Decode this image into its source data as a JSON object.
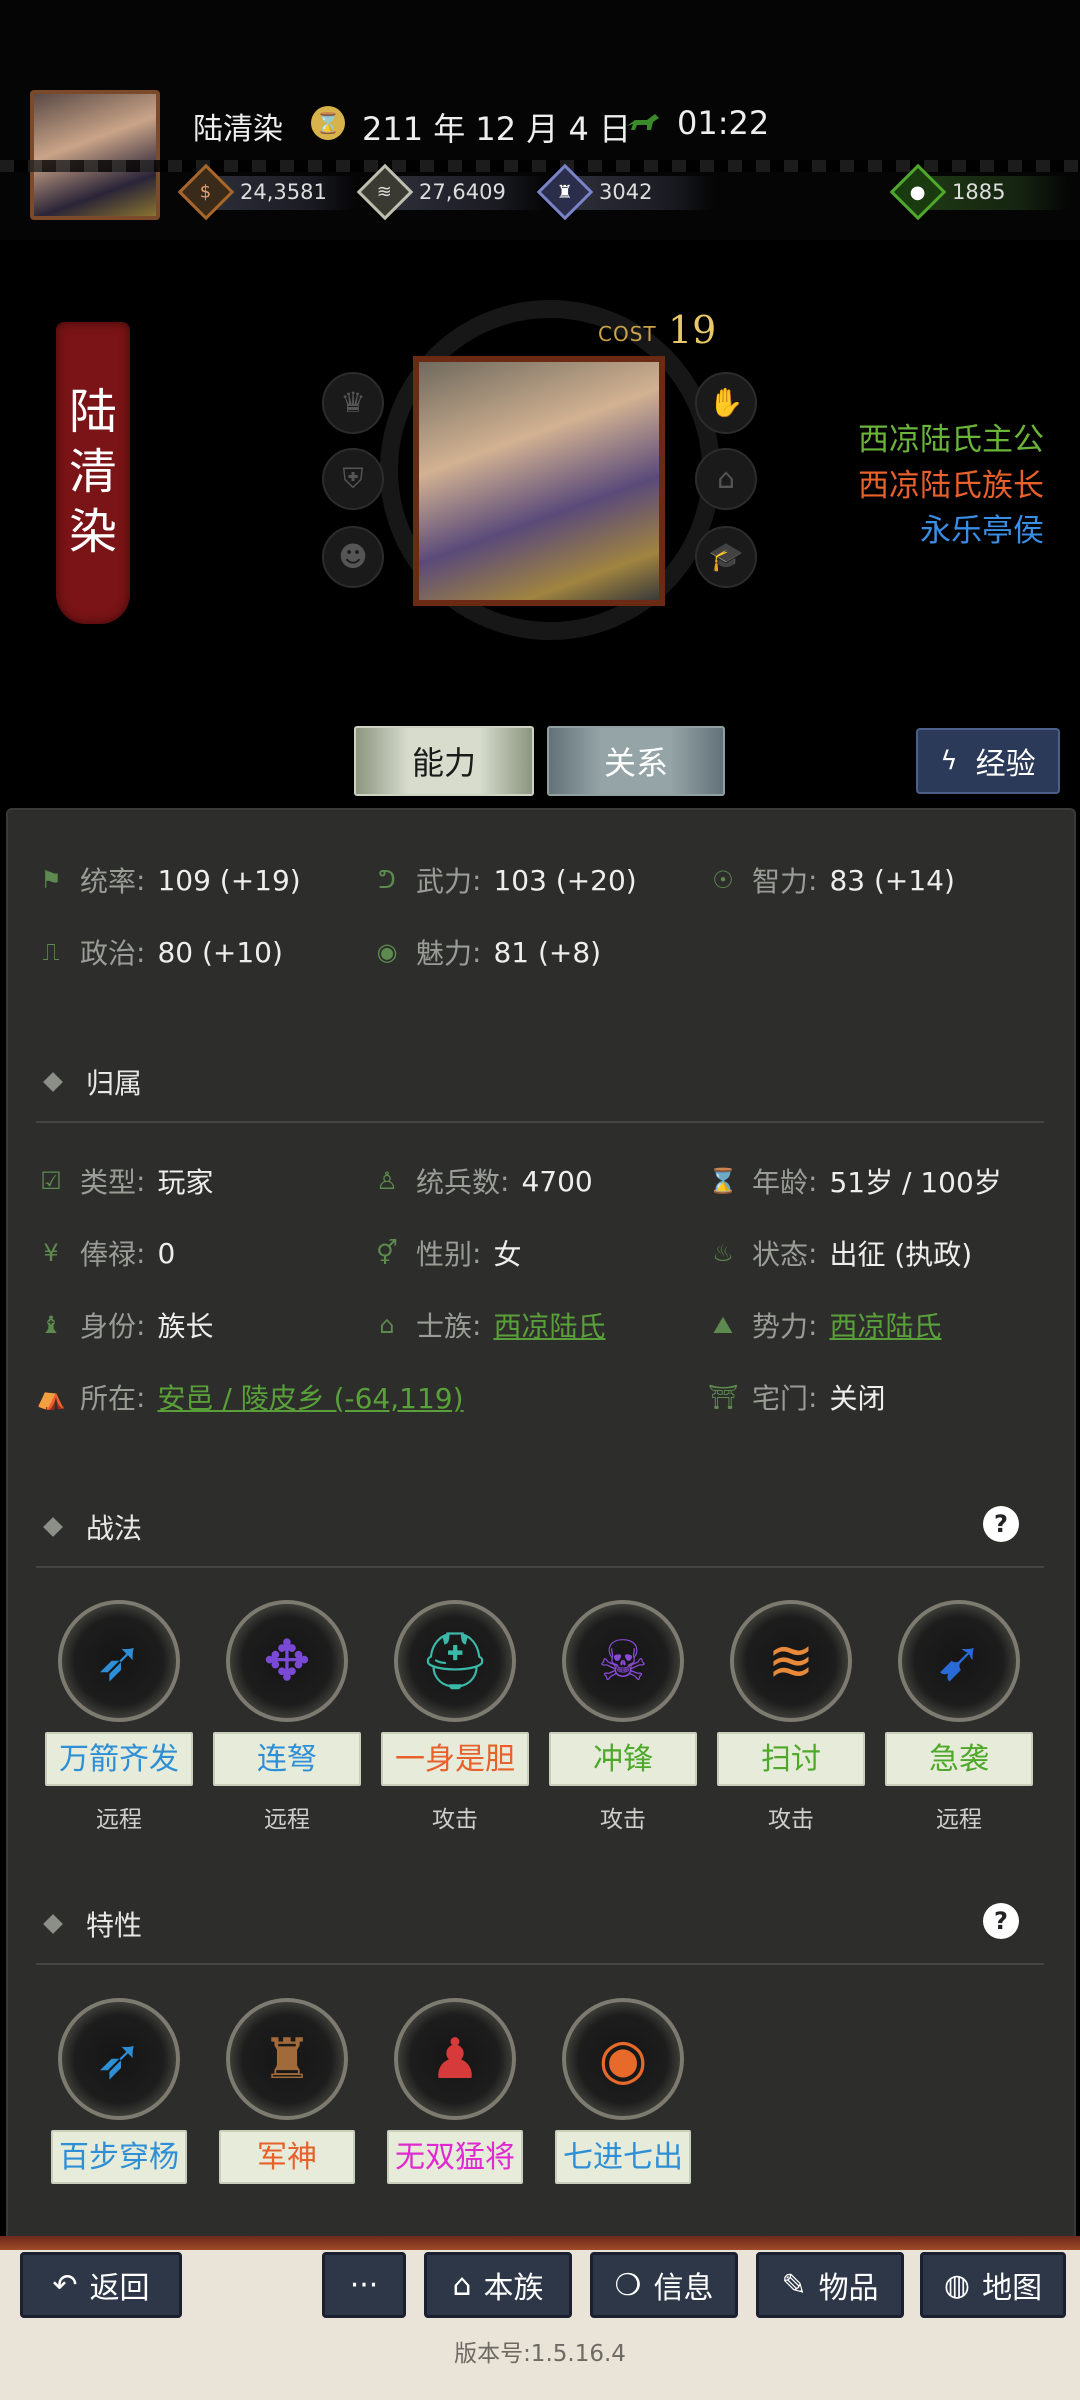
{
  "header": {
    "player_name": "陆清染",
    "date": "211 年 12 月 4 日",
    "time": "01:22",
    "resources": [
      {
        "name": "money",
        "icon": "coin-icon",
        "value": "24,3581"
      },
      {
        "name": "food",
        "icon": "grain-icon",
        "value": "27,6409"
      },
      {
        "name": "troops",
        "icon": "soldier-icon",
        "value": "3042"
      },
      {
        "name": "special",
        "icon": "pouch-icon",
        "value": "1885"
      }
    ]
  },
  "hero": {
    "name_chars": [
      "陆",
      "清",
      "染"
    ],
    "cost_label": "COST",
    "cost_value": "19",
    "titles": [
      {
        "text": "西凉陆氏主公",
        "color": "#6ab43a"
      },
      {
        "text": "西凉陆氏族长",
        "color": "#e8602a"
      },
      {
        "text": "永乐亭侯",
        "color": "#3a8ee6"
      }
    ]
  },
  "tabs": {
    "ability": "能力",
    "relation": "关系",
    "exp": "经验"
  },
  "stats": [
    {
      "label": "统率",
      "value": "109 (+19)",
      "icon": "flag-icon"
    },
    {
      "label": "武力",
      "value": "103 (+20)",
      "icon": "arm-icon"
    },
    {
      "label": "智力",
      "value": "83 (+14)",
      "icon": "brain-icon"
    },
    {
      "label": "政治",
      "value": "80 (+10)",
      "icon": "scroll-icon"
    },
    {
      "label": "魅力",
      "value": "81 (+8)",
      "icon": "eye-icon"
    }
  ],
  "affiliation": {
    "heading": "归属",
    "rows": [
      {
        "label": "类型",
        "value": "玩家",
        "icon": "calendar-check-icon"
      },
      {
        "label": "统兵数",
        "value": "4700",
        "icon": "person-icon"
      },
      {
        "label": "年龄",
        "value": "51岁 / 100岁",
        "icon": "age-icon"
      },
      {
        "label": "俸禄",
        "value": "0",
        "icon": "yen-icon"
      },
      {
        "label": "性别",
        "value": "女",
        "icon": "gender-icon"
      },
      {
        "label": "状态",
        "value": "出征 (执政)",
        "icon": "status-icon"
      },
      {
        "label": "身份",
        "value": "族长",
        "icon": "chess-icon"
      },
      {
        "label": "士族",
        "value": "西凉陆氏",
        "icon": "hat-icon",
        "link": true
      },
      {
        "label": "势力",
        "value": "西凉陆氏",
        "icon": "mountain-icon",
        "link": true
      },
      {
        "label": "所在",
        "value": "安邑 / 陵皮乡 (-64,119)",
        "icon": "tent-icon",
        "link": true
      },
      {
        "label": "宅门",
        "value": "关闭",
        "icon": "gate-icon"
      }
    ]
  },
  "tactics": {
    "heading": "战法",
    "items": [
      {
        "name": "万箭齐发",
        "type": "远程",
        "color": "#2f8fd6",
        "icon": "arrows-icon"
      },
      {
        "name": "连弩",
        "type": "远程",
        "color": "#2f8fd6",
        "icon": "crossbow-icon"
      },
      {
        "name": "一身是胆",
        "type": "攻击",
        "color": "#e8602a",
        "icon": "helmet-icon"
      },
      {
        "name": "冲锋",
        "type": "攻击",
        "color": "#4ea82a",
        "icon": "charge-icon"
      },
      {
        "name": "扫讨",
        "type": "攻击",
        "color": "#4ea82a",
        "icon": "sweep-icon"
      },
      {
        "name": "急袭",
        "type": "远程",
        "color": "#4ea82a",
        "icon": "raid-icon"
      }
    ]
  },
  "traits": {
    "heading": "特性",
    "items": [
      {
        "name": "百步穿杨",
        "color": "#2f8fd6",
        "icon": "pierce-arrow-icon"
      },
      {
        "name": "军神",
        "color": "#e8602a",
        "icon": "war-god-icon"
      },
      {
        "name": "无双猛将",
        "color": "#e02ad0",
        "icon": "strongman-icon"
      },
      {
        "name": "七进七出",
        "color": "#2f8fd6",
        "icon": "eye-shield-icon"
      }
    ]
  },
  "bottom_nav": {
    "back": "返回",
    "more": "···",
    "clan": "本族",
    "info": "信息",
    "items": "物品",
    "map": "地图",
    "version": "版本号:1.5.16.4"
  }
}
